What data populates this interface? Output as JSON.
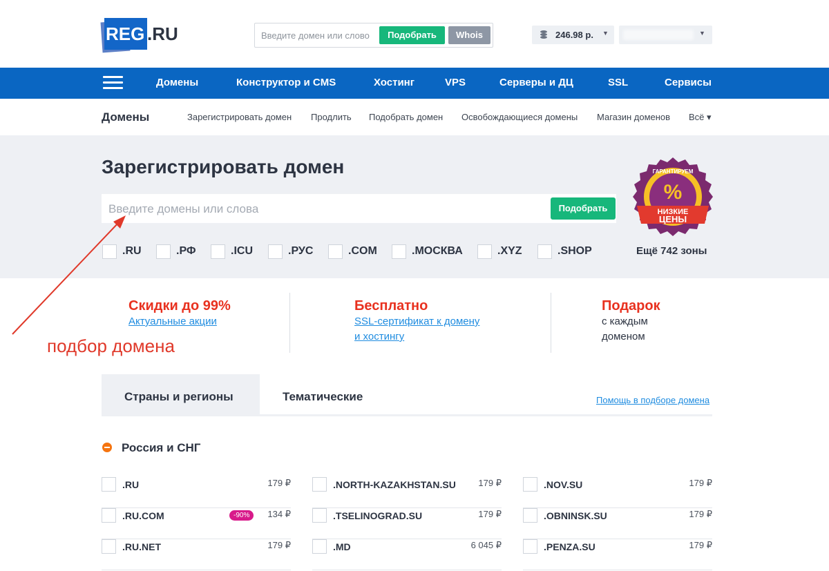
{
  "header": {
    "logo_main": "REG",
    "logo_suffix": ".RU",
    "search_placeholder": "Введите домен или слово",
    "search_button": "Подобрать",
    "whois_button": "Whois",
    "balance": "246.98 р."
  },
  "nav": {
    "items": [
      "Домены",
      "Конструктор и CMS",
      "Хостинг",
      "VPS",
      "Серверы и ДЦ",
      "SSL",
      "Сервисы"
    ]
  },
  "subnav": {
    "title": "Домены",
    "links": [
      "Зарегистрировать домен",
      "Продлить",
      "Подобрать домен",
      "Освобождающиеся домены",
      "Магазин доменов",
      "Всё ▾"
    ]
  },
  "register": {
    "heading": "Зарегистрировать домен",
    "placeholder": "Введите домены или слова",
    "button": "Подобрать",
    "zones": [
      ".RU",
      ".РФ",
      ".ICU",
      ".РУС",
      ".COM",
      ".МОСКВА",
      ".XYZ",
      ".SHOP"
    ],
    "more_zones": "Ещё 742 зоны",
    "badge": {
      "top": "ГАРАНТИРУЕМ",
      "symbol": "%",
      "line1": "НИЗКИЕ",
      "line2": "ЦЕНЫ"
    }
  },
  "promos": [
    {
      "title": "Скидки до 99%",
      "link1": "Актуальные акции",
      "link2": ""
    },
    {
      "title": "Бесплатно",
      "link1": "SSL-сертификат к домену",
      "link2": "и хостингу"
    },
    {
      "title": "Подарок",
      "text1": "с каждым",
      "text2": "доменом"
    }
  ],
  "annotation": "подбор домена",
  "tabs": {
    "active": "Страны и регионы",
    "second": "Тематические",
    "help": "Помощь в подборе домена"
  },
  "region": {
    "title": "Россия и СНГ",
    "columns": [
      [
        {
          "name": ".RU",
          "price": "179 ₽",
          "discount": ""
        },
        {
          "name": ".RU.COM",
          "price": "134 ₽",
          "discount": "-90%"
        },
        {
          "name": ".RU.NET",
          "price": "179 ₽",
          "discount": ""
        }
      ],
      [
        {
          "name": ".NORTH-KAZAKHSTAN.SU",
          "price": "179 ₽",
          "discount": ""
        },
        {
          "name": ".TSELINOGRAD.SU",
          "price": "179 ₽",
          "discount": ""
        },
        {
          "name": ".MD",
          "price": "6 045 ₽",
          "discount": ""
        }
      ],
      [
        {
          "name": ".NOV.SU",
          "price": "179 ₽",
          "discount": ""
        },
        {
          "name": ".OBNINSK.SU",
          "price": "179 ₽",
          "discount": ""
        },
        {
          "name": ".PENZA.SU",
          "price": "179 ₽",
          "discount": ""
        }
      ]
    ]
  },
  "colors": {
    "brand_blue": "#0a66c2",
    "green_button": "#17b77b",
    "promo_red": "#e8311f",
    "link_blue": "#1f8ce0",
    "annotation_red": "#e0392a",
    "discount_pink": "#d81b8a"
  }
}
